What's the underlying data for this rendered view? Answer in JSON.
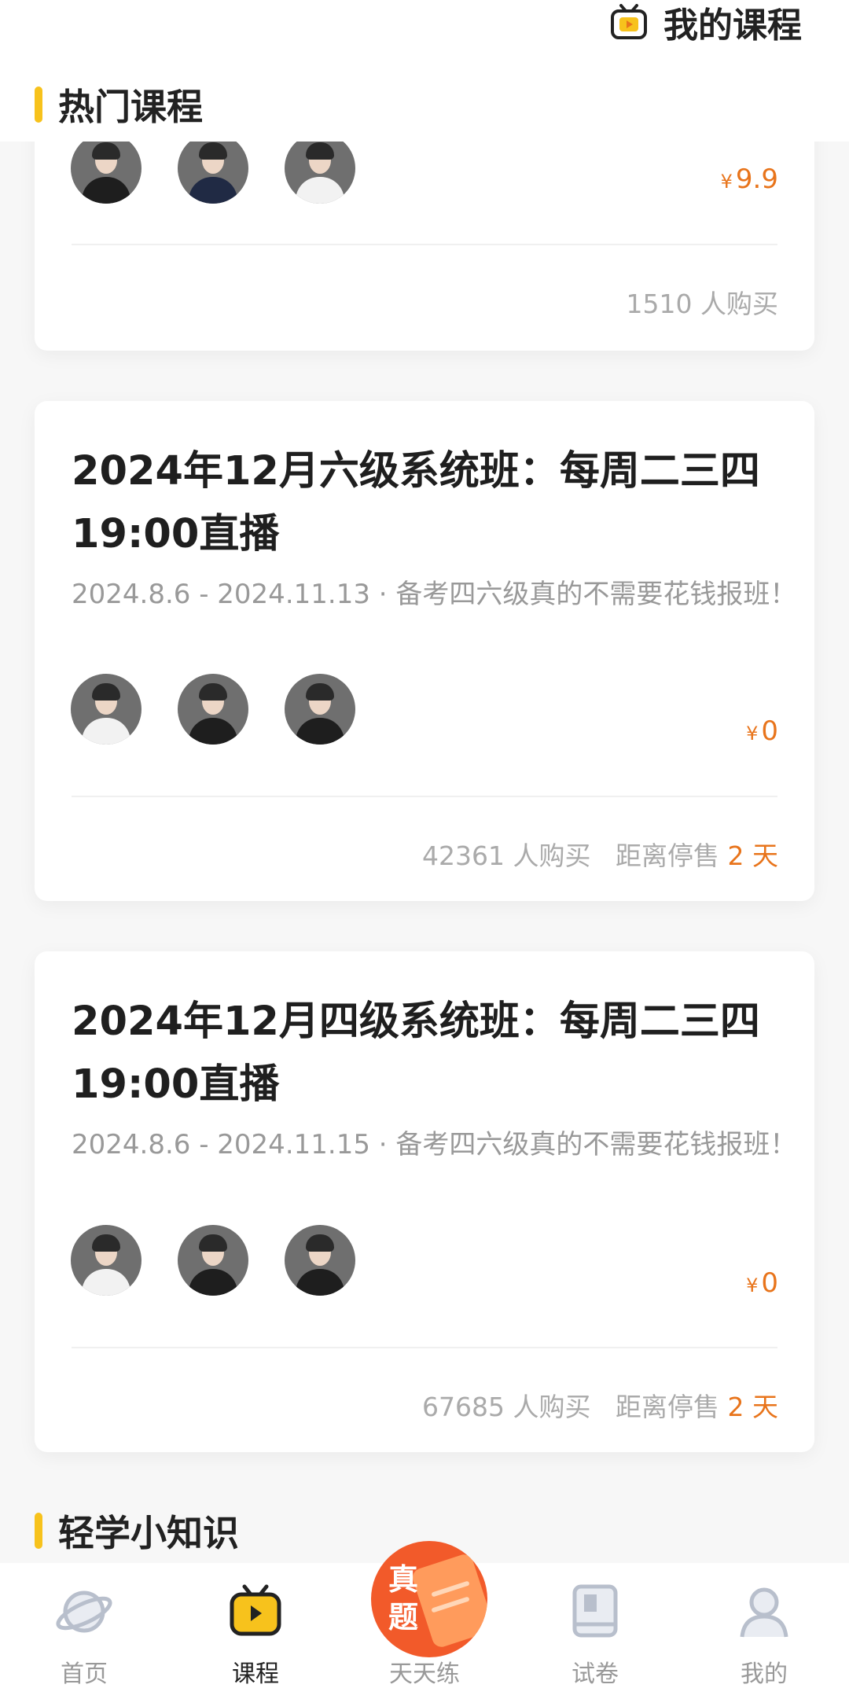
{
  "header": {
    "my_courses_label": "我的课程",
    "section_title": "热门课程"
  },
  "cards": [
    {
      "price_symbol": "¥",
      "price": "9.9",
      "buyers": "1510 人购买"
    },
    {
      "title": "2024年12月六级系统班：每周二三四19:00直播",
      "subtitle": "2024.8.6 - 2024.11.13 · 备考四六级真的不需要花钱报班！",
      "price_symbol": "¥",
      "price": "0",
      "buyers": "42361 人购买",
      "stop_label": "距离停售",
      "stop_days": "2 天"
    },
    {
      "title": "2024年12月四级系统班：每周二三四19:00直播",
      "subtitle": "2024.8.6 - 2024.11.15 · 备考四六级真的不需要花钱报班！",
      "price_symbol": "¥",
      "price": "0",
      "buyers": "67685 人购买",
      "stop_label": "距离停售",
      "stop_days": "2 天"
    }
  ],
  "knowledge_section_title": "轻学小知识",
  "bottom_nav": {
    "items": [
      {
        "label": "首页",
        "icon": "planet-icon",
        "active": false
      },
      {
        "label": "课程",
        "icon": "tv-icon",
        "active": true
      },
      {
        "label": "天天练",
        "icon": "practice-icon",
        "active": false
      },
      {
        "label": "试卷",
        "icon": "paper-icon",
        "active": false
      },
      {
        "label": "我的",
        "icon": "user-icon",
        "active": false
      }
    ],
    "center_badge_line1": "真",
    "center_badge_line2": "题"
  },
  "colors": {
    "accent_yellow": "#f7c21c",
    "price_orange": "#e8741b",
    "badge_red": "#f25a2a"
  }
}
